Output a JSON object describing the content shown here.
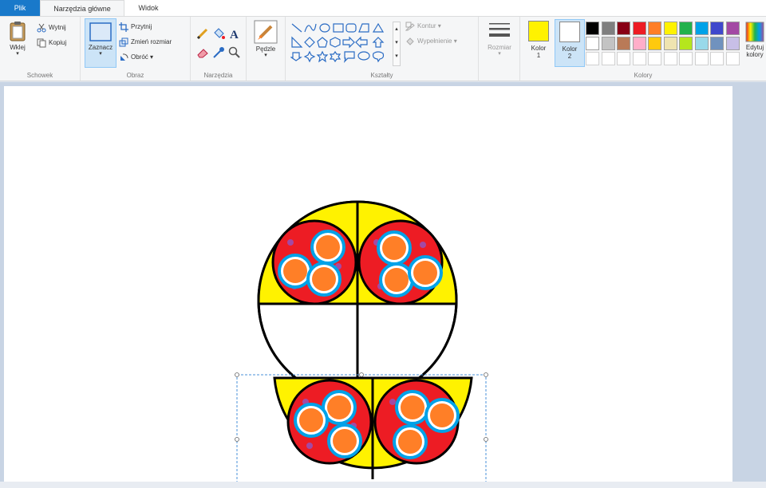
{
  "tabs": [
    {
      "label": "Plik"
    },
    {
      "label": "Narzędzia główne"
    },
    {
      "label": "Widok"
    }
  ],
  "groups": {
    "clipboard": {
      "label": "Schowek",
      "paste": "Wklej",
      "cut": "Wytnij",
      "copy": "Kopiuj"
    },
    "image": {
      "label": "Obraz",
      "select": "Zaznacz",
      "crop": "Przytnij",
      "resize": "Zmień rozmiar",
      "rotate": "Obróć"
    },
    "tools": {
      "label": "Narzędzia",
      "icons": [
        "pencil-icon",
        "fill-bucket-icon",
        "text-icon",
        "eraser-icon",
        "color-picker-icon",
        "magnifier-icon"
      ]
    },
    "brushes": {
      "label": "Pędzle"
    },
    "shapes": {
      "label": "Kształty",
      "outline": "Kontur",
      "fill": "Wypełnienie"
    },
    "size": {
      "label": "Rozmiar"
    },
    "colors": {
      "label": "Kolory",
      "color1_label_a": "Kolor",
      "color1_label_b": "1",
      "color2_label_a": "Kolor",
      "color2_label_b": "2",
      "edit_label_a": "Edytuj",
      "edit_label_b": "kolory",
      "color1": "#fff200",
      "color2": "#ffffff",
      "palette": [
        [
          "#000000",
          "#7f7f7f",
          "#880015",
          "#ed1c24",
          "#ff7f27",
          "#fff200",
          "#22b14c",
          "#00a2e8",
          "#3f48cc",
          "#a349a4"
        ],
        [
          "#ffffff",
          "#c3c3c3",
          "#b97a57",
          "#ffaec9",
          "#ffc90e",
          "#efe4b0",
          "#b5e61d",
          "#99d9ea",
          "#7092be",
          "#c8bfe7"
        ],
        [
          "#ffffff",
          "#ffffff",
          "#ffffff",
          "#ffffff",
          "#ffffff",
          "#ffffff",
          "#ffffff",
          "#ffffff",
          "#ffffff",
          "#ffffff"
        ]
      ]
    }
  },
  "drawing": {
    "yellow": "#fff200",
    "red": "#ed1c24",
    "orange": "#ff7f27",
    "blue": "#00a2e8",
    "purple": "#a349a4"
  }
}
